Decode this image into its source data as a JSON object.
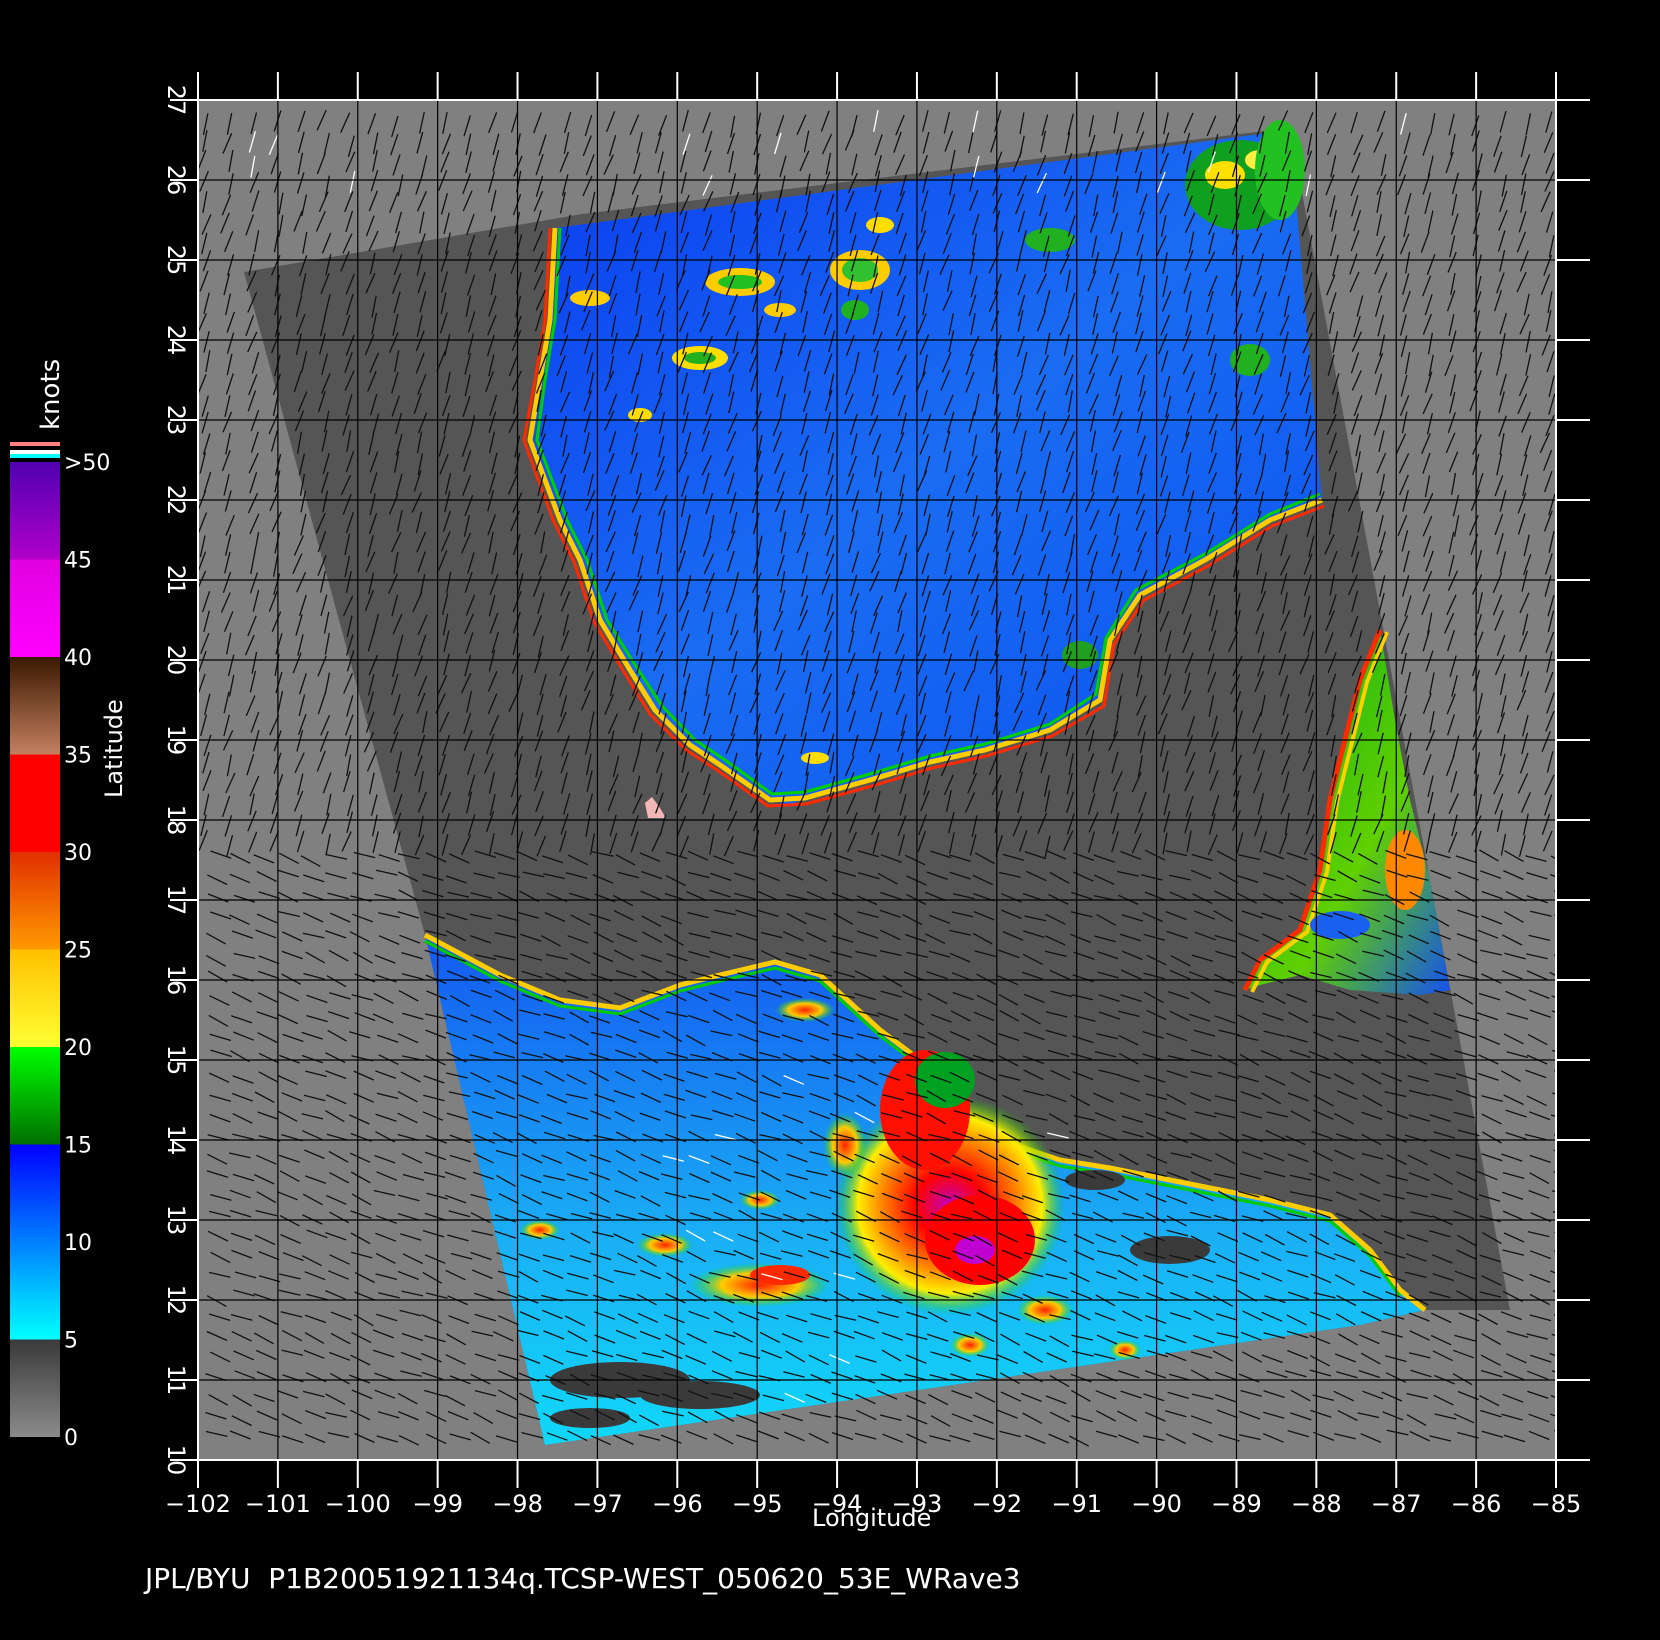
{
  "map": {
    "x_axis": {
      "title": "Longitude",
      "min": -102,
      "max": -85,
      "ticks": [
        -102,
        -101,
        -100,
        -99,
        -98,
        -97,
        -96,
        -95,
        -94,
        -93,
        -92,
        -91,
        -90,
        -89,
        -88,
        -87,
        -86,
        -85
      ]
    },
    "y_axis": {
      "title": "Latitude",
      "min": 10,
      "max": 27,
      "ticks": [
        10,
        11,
        12,
        13,
        14,
        15,
        16,
        17,
        18,
        19,
        20,
        21,
        22,
        23,
        24,
        25,
        26,
        27
      ]
    },
    "grid": true,
    "colors": {
      "background": "#000000",
      "outside_swath": "#808080",
      "land": "#555555",
      "grid": "#000000",
      "ice": "#f4b7b7"
    }
  },
  "colorbar": {
    "unit": "knots",
    "labels": [
      ">50",
      "45",
      "40",
      "35",
      "30",
      "25",
      "20",
      "15",
      "10",
      "5",
      "0"
    ],
    "bands": [
      {
        "from": 0,
        "to": 5,
        "colors": [
          "#8a8a8a",
          "#3a3a3a"
        ]
      },
      {
        "from": 5,
        "to": 15,
        "colors": [
          "#00ffff",
          "#0000ff"
        ]
      },
      {
        "from": 15,
        "to": 20,
        "colors": [
          "#006f00",
          "#00ff00"
        ]
      },
      {
        "from": 20,
        "to": 25,
        "colors": [
          "#ffff33",
          "#ffc000"
        ]
      },
      {
        "from": 25,
        "to": 30,
        "colors": [
          "#ff9900",
          "#e03000"
        ]
      },
      {
        "from": 30,
        "to": 35,
        "colors": [
          "#ff0000",
          "#ff0000"
        ]
      },
      {
        "from": 35,
        "to": 40,
        "colors": [
          "#c48060",
          "#3a1800"
        ]
      },
      {
        "from": 40,
        "to": 45,
        "colors": [
          "#ff00ff",
          "#e000e0"
        ]
      },
      {
        "from": 45,
        "to": 50,
        "colors": [
          "#b000c8",
          "#5000b0"
        ]
      }
    ]
  },
  "credit": "JPL/BYU  P1B20051921134q.TCSP-WEST_050620_53E_WRave3"
}
